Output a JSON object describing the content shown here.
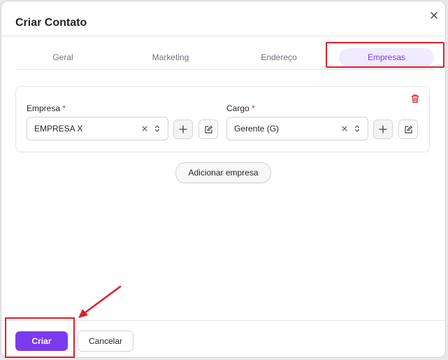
{
  "dialog": {
    "title": "Criar Contato",
    "close_icon": "close-icon"
  },
  "tabs": [
    {
      "label": "Geral",
      "active": false
    },
    {
      "label": "Marketing",
      "active": false
    },
    {
      "label": "Endereço",
      "active": false
    },
    {
      "label": "Empresas",
      "active": true
    }
  ],
  "company_entry": {
    "empresa": {
      "label": "Empresa",
      "required_mark": "*",
      "value": "EMPRESA X"
    },
    "cargo": {
      "label": "Cargo",
      "required_mark": "*",
      "value": "Gerente (G)"
    },
    "delete_icon": "trash-icon"
  },
  "actions": {
    "add_company": "Adicionar empresa",
    "create": "Criar",
    "cancel": "Cancelar"
  },
  "colors": {
    "accent": "#7c3aed",
    "accent_light": "#f0ebff",
    "annotation_red": "#e11d2a",
    "required_red": "#dc2626"
  }
}
